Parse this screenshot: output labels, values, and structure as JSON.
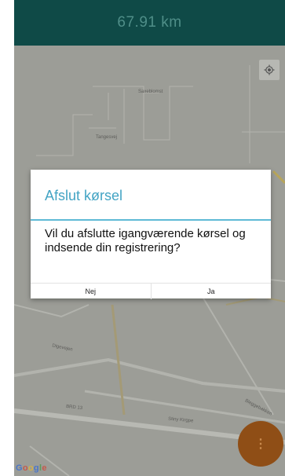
{
  "header": {
    "distance": "67.91 km",
    "background": "#0f4a47"
  },
  "map": {
    "street_labels": [
      "Saxeblomst",
      "Tangesvej",
      "Digevejen",
      "Stiny Kirgpe",
      "Bleggebakken"
    ],
    "road_number": "BRD 13",
    "attribution": "Google",
    "locate_icon": "my-location-icon"
  },
  "dialog": {
    "title": "Afslut kørsel",
    "message": "Vil du afslutte igangværende kørsel og indsende din registrering?",
    "buttons": {
      "no": "Nej",
      "yes": "Ja"
    },
    "accent": "#43a4c4"
  },
  "fab": {
    "icon": "more-vert-icon",
    "label": "⋮",
    "color": "#8f4e16"
  }
}
